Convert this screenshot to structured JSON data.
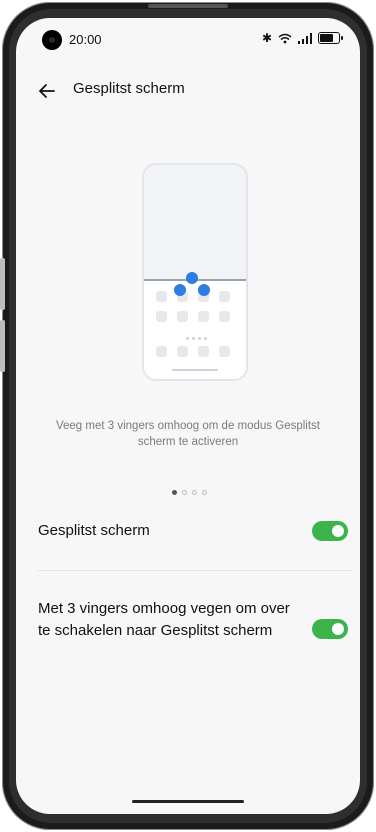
{
  "status_bar": {
    "time": "20:00"
  },
  "header": {
    "title": "Gesplitst scherm"
  },
  "illustration": {
    "description": "Veeg met 3 vingers omhoog om de modus Gesplitst scherm te activeren"
  },
  "pager": {
    "pages": 4,
    "active": 1
  },
  "settings": [
    {
      "label": "Gesplitst scherm",
      "enabled": true
    },
    {
      "label": "Met 3 vingers omhoog vegen om over te schakelen naar Gesplitst scherm",
      "enabled": true
    }
  ],
  "colors": {
    "toggle_on": "#3cb44b",
    "accent_blue": "#2b7ee3"
  }
}
